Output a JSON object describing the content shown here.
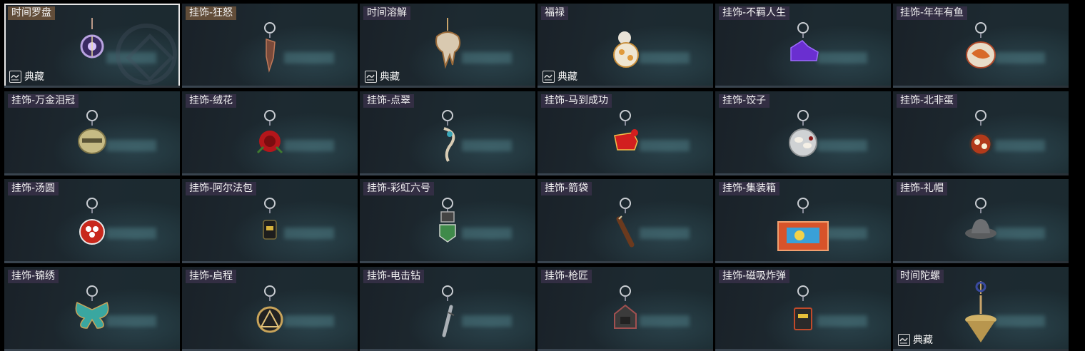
{
  "badge_text": "典藏",
  "items": [
    {
      "name": "时间罗盘",
      "selected": true,
      "collectible": true,
      "icon": "compass-charm-icon"
    },
    {
      "name": "挂饰-狂怒",
      "icon": "rage-charm-icon"
    },
    {
      "name": "时间溶解",
      "collectible": true,
      "icon": "melting-clock-charm-icon"
    },
    {
      "name": "福禄",
      "collectible": true,
      "icon": "gourd-charm-icon"
    },
    {
      "name": "挂饰-不羁人生",
      "icon": "sneaker-charm-icon"
    },
    {
      "name": "挂饰-年年有鱼",
      "icon": "fish-plate-charm-icon"
    },
    {
      "name": "挂饰-万金泪冠",
      "icon": "crown-charm-icon"
    },
    {
      "name": "挂饰-绒花",
      "icon": "rose-charm-icon"
    },
    {
      "name": "挂饰-点翠",
      "icon": "phoenix-charm-icon"
    },
    {
      "name": "挂饰-马到成功",
      "icon": "red-horse-charm-icon"
    },
    {
      "name": "挂饰-饺子",
      "icon": "dumpling-plate-charm-icon"
    },
    {
      "name": "挂饰-北非蛋",
      "icon": "shakshuka-pan-charm-icon"
    },
    {
      "name": "挂饰-汤圆",
      "icon": "tangyuan-bowl-charm-icon"
    },
    {
      "name": "挂饰-阿尔法包",
      "icon": "alpha-bag-charm-icon"
    },
    {
      "name": "挂饰-彩虹六号",
      "icon": "rainbow-six-charm-icon"
    },
    {
      "name": "挂饰-箭袋",
      "icon": "quiver-charm-icon"
    },
    {
      "name": "挂饰-集装箱",
      "icon": "shipping-container-charm-icon"
    },
    {
      "name": "挂饰-礼帽",
      "icon": "fedora-charm-icon"
    },
    {
      "name": "挂饰-锦绣",
      "icon": "butterfly-charm-icon"
    },
    {
      "name": "挂饰-启程",
      "icon": "triangle-medal-charm-icon"
    },
    {
      "name": "挂饰-电击钻",
      "icon": "drill-bit-charm-icon"
    },
    {
      "name": "挂饰-枪匠",
      "icon": "gunsmith-box-charm-icon"
    },
    {
      "name": "挂饰-磁吸炸弹",
      "icon": "magnetic-bomb-charm-icon"
    },
    {
      "name": "时间陀螺",
      "collectible": true,
      "icon": "spinning-top-charm-icon"
    }
  ]
}
